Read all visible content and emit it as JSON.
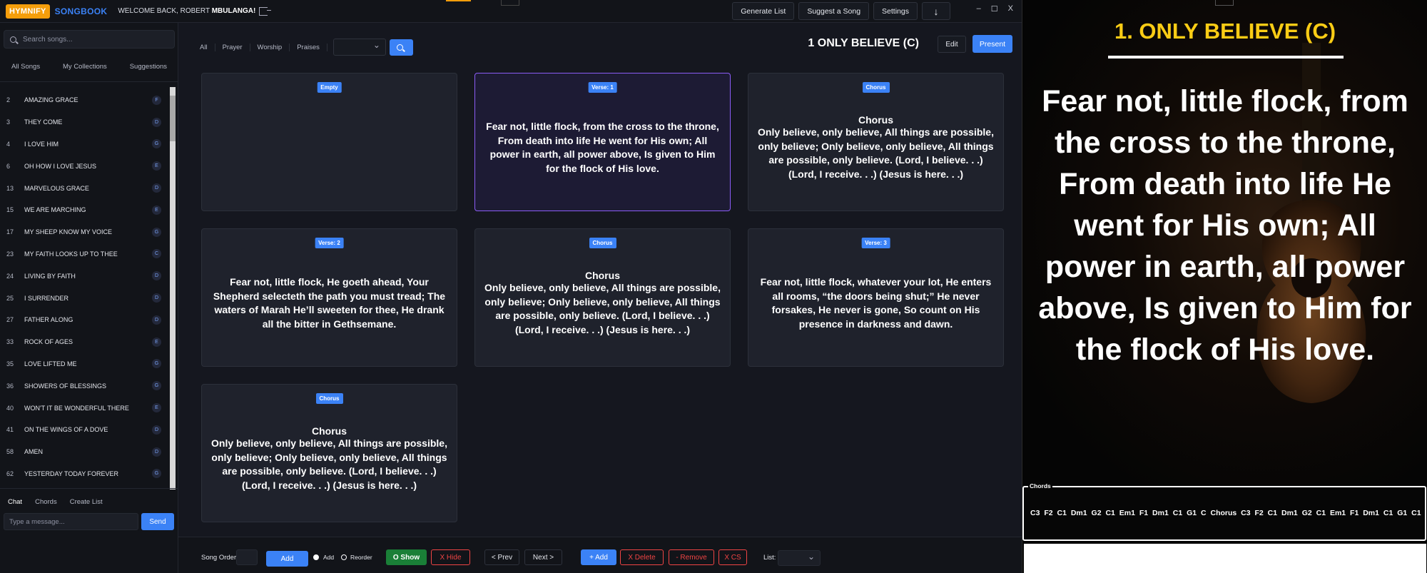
{
  "header": {
    "logo": "HYMNIFY",
    "brand": "SONGBOOK",
    "welcome_prefix": "WELCOME BACK, ROBERT",
    "welcome_name": "MBULANGA!",
    "actions": [
      "Generate List",
      "Suggest a Song",
      "Settings"
    ],
    "download_label": "↓",
    "window_controls": [
      "–",
      "☐",
      "X"
    ]
  },
  "sidebar": {
    "search_placeholder": "Search songs...",
    "tabs": [
      "All Songs",
      "My Collections",
      "Suggestions"
    ],
    "songs": [
      {
        "num": "2",
        "title": "AMAZING GRACE",
        "key": "F"
      },
      {
        "num": "3",
        "title": "THEY COME",
        "key": "D"
      },
      {
        "num": "4",
        "title": "I LOVE HIM",
        "key": "G"
      },
      {
        "num": "6",
        "title": "OH HOW I LOVE JESUS",
        "key": "E"
      },
      {
        "num": "13",
        "title": "MARVELOUS GRACE",
        "key": "D"
      },
      {
        "num": "15",
        "title": "WE ARE MARCHING",
        "key": "E"
      },
      {
        "num": "17",
        "title": "MY SHEEP KNOW MY VOICE",
        "key": "G"
      },
      {
        "num": "23",
        "title": "MY FAITH LOOKS UP TO THEE",
        "key": "C"
      },
      {
        "num": "24",
        "title": "LIVING BY FAITH",
        "key": "D"
      },
      {
        "num": "25",
        "title": "I SURRENDER",
        "key": "D"
      },
      {
        "num": "27",
        "title": "FATHER ALONG",
        "key": "D"
      },
      {
        "num": "33",
        "title": "ROCK OF AGES",
        "key": "E"
      },
      {
        "num": "35",
        "title": "LOVE LIFTED ME",
        "key": "G"
      },
      {
        "num": "36",
        "title": "SHOWERS OF BLESSINGS",
        "key": "G"
      },
      {
        "num": "40",
        "title": "WON'T IT BE WONDERFUL THERE",
        "key": "E"
      },
      {
        "num": "41",
        "title": "ON THE WINGS OF A DOVE",
        "key": "D"
      },
      {
        "num": "58",
        "title": "AMEN",
        "key": "D"
      },
      {
        "num": "62",
        "title": "YESTERDAY TODAY FOREVER",
        "key": "G"
      }
    ],
    "chat_tabs": [
      "Chat",
      "Chords",
      "Create List"
    ],
    "message_placeholder": "Type a message...",
    "send_label": "Send"
  },
  "main": {
    "filters": [
      "All",
      "Prayer",
      "Worship",
      "Praises"
    ],
    "song_heading": "1 ONLY BELIEVE (C)",
    "edit_label": "Edit",
    "present_label": "Present",
    "cards": [
      {
        "badge": "Empty",
        "head": "",
        "text": "",
        "selected": false
      },
      {
        "badge": "Verse: 1",
        "head": "",
        "text": "Fear not, little flock, from the cross to the throne, From death into life He went for His own; All power in earth, all power above, Is given to Him for the flock of His love.",
        "selected": true
      },
      {
        "badge": "Chorus",
        "head": "Chorus",
        "text": "Only believe, only believe, All things are possible, only believe; Only believe, only believe, All things are possible, only believe. (Lord, I believe. . .) (Lord, I receive. . .) (Jesus is here. . .)",
        "selected": false
      },
      {
        "badge": "Verse: 2",
        "head": "",
        "text": "Fear not, little flock, He goeth ahead, Your Shepherd selecteth the path you must tread; The waters of Marah He’ll sweeten for thee, He drank all the bitter in Gethsemane.",
        "selected": false
      },
      {
        "badge": "Chorus",
        "head": "Chorus",
        "text": "Only believe, only believe, All things are possible, only believe; Only believe, only believe, All things are possible, only believe. (Lord, I believe. . .) (Lord, I receive. . .) (Jesus is here. . .)",
        "selected": false
      },
      {
        "badge": "Verse: 3",
        "head": "",
        "text": "Fear not, little flock, whatever your lot, He enters all rooms, “the doors being shut;” He never forsakes, He never is gone, So count on His presence in darkness and dawn.",
        "selected": false
      },
      {
        "badge": "Chorus",
        "head": "Chorus",
        "text": "Only believe, only believe, All things are possible, only believe; Only believe, only believe, All things are possible, only believe. (Lord, I believe. . .) (Lord, I receive. . .) (Jesus is here. . .)",
        "selected": false
      }
    ]
  },
  "toolbar": {
    "song_order_label": "Song Order",
    "add_label": "Add",
    "radio_add": "Add",
    "radio_reorder": "Reorder",
    "show_label": "O Show",
    "hide_label": "X Hide",
    "prev_label": "< Prev",
    "next_label": "Next >",
    "plus_add_label": "+ Add",
    "delete_label": "X Delete",
    "remove_label": "- Remove",
    "cs_label": "X CS",
    "list_label": "List:"
  },
  "presenter": {
    "title": "1. ONLY BELIEVE (C)",
    "lyrics": "Fear not, little flock, from the cross to the throne, From death into life He went for His own; All power in earth, all power above, Is given to Him for the flock of His love.",
    "chords_legend": "Chords",
    "chords": "C3 F2 C1 Dm1 G2 C1 Em1 F1 Dm1 C1 G1 C Chorus C3 F2 C1 Dm1 G2 C1 Em1 F1 Dm1 C1 G1 C1"
  },
  "colors": {
    "accent": "#3b82f6",
    "logo": "#f59e0b",
    "title_yellow": "#facc15",
    "selected_border": "#8b5cf6",
    "show_green": "#1a7f37",
    "danger_red": "#ef4444"
  }
}
